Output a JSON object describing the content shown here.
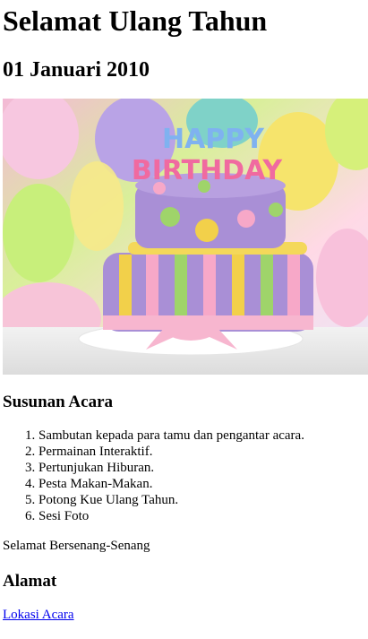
{
  "title": "Selamat Ulang Tahun",
  "date": "01 Januari 2010",
  "image": {
    "alt": "birthday-cake-photo",
    "topper_line1": "HAPPY",
    "topper_line2": "BIRTHDAY",
    "colors": {
      "cake_purple": "#a98fd6",
      "cake_pink": "#f7a8c8",
      "cake_yellow": "#f2d04a",
      "cake_green": "#9fd46a",
      "bg_teal": "#7fd2c8"
    }
  },
  "agenda": {
    "heading": "Susunan Acara",
    "items": [
      "Sambutan kepada para tamu dan pengantar acara.",
      "Permainan Interaktif.",
      "Pertunjukan Hiburan.",
      "Pesta Makan-Makan.",
      "Potong Kue Ulang Tahun.",
      "Sesi Foto"
    ]
  },
  "greeting": "Selamat Bersenang-Senang",
  "address": {
    "heading": "Alamat",
    "link_label": "Lokasi Acara"
  }
}
